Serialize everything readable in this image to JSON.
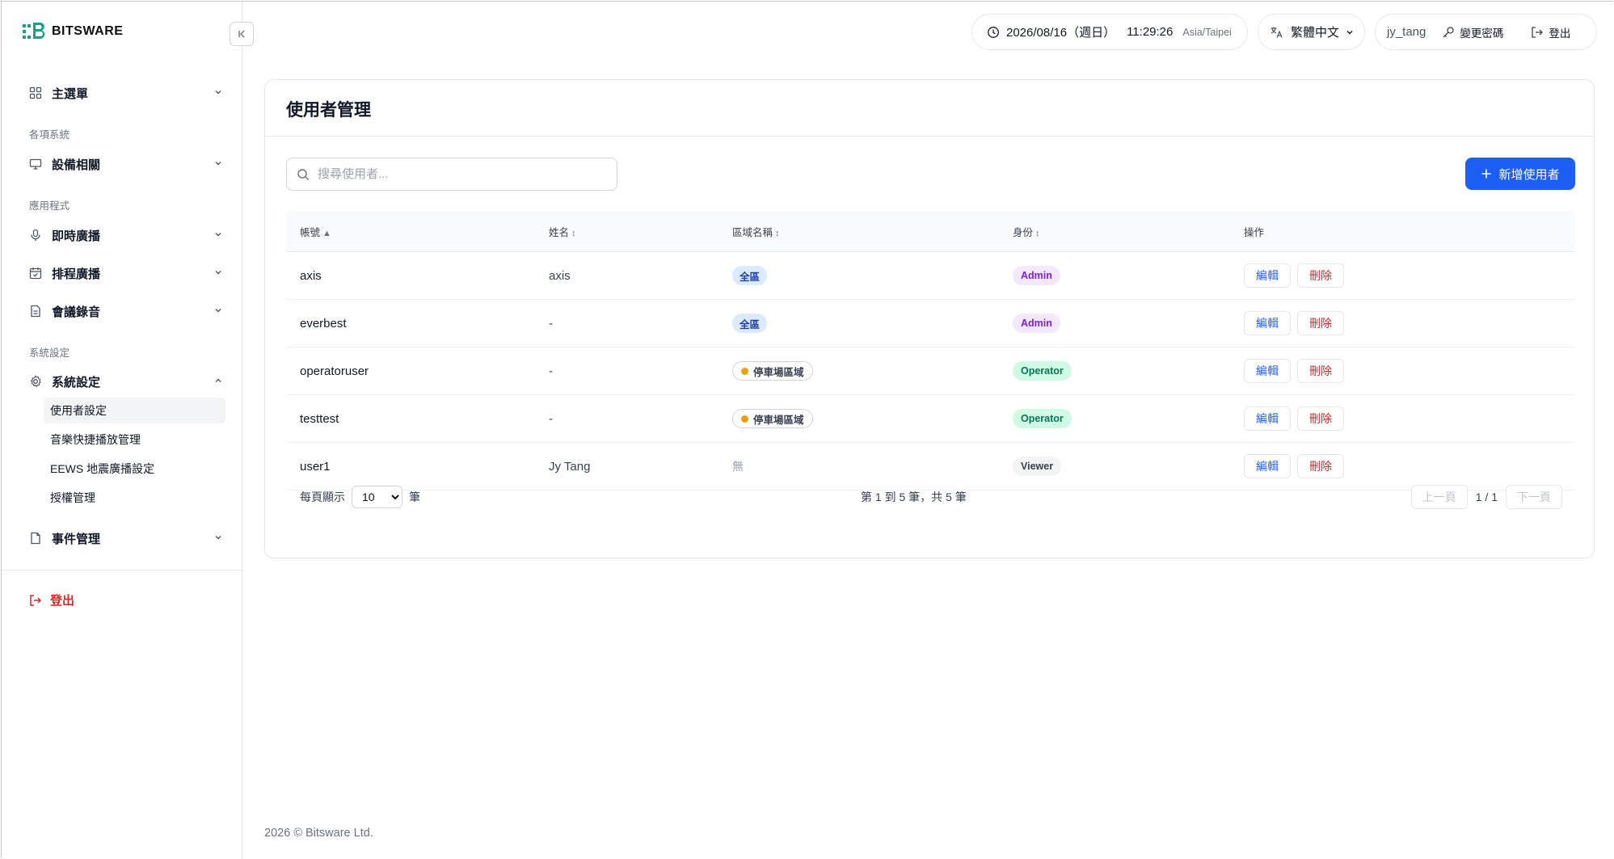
{
  "brand": {
    "name": "BITSWARE",
    "color": "#16a08a"
  },
  "topbar": {
    "date": "2026/08/16（週日）",
    "time": "11:29:26",
    "timezone": "Asia/Taipei",
    "language": "繁體中文",
    "username": "jy_tang",
    "change_password": "變更密碼",
    "logout": "登出"
  },
  "sidebar": {
    "main_menu": "主選單",
    "section_systems": "各項系統",
    "devices": "設備相關",
    "section_apps": "應用程式",
    "live_broadcast": "即時廣播",
    "scheduled_broadcast": "排程廣播",
    "meeting_recording": "會議錄音",
    "section_settings": "系統設定",
    "system_settings": "系統設定",
    "sub_items": [
      "使用者設定",
      "音樂快捷播放管理",
      "EEWS 地震廣播設定",
      "授權管理"
    ],
    "events": "事件管理",
    "logout": "登出"
  },
  "page": {
    "title": "使用者管理",
    "search_placeholder": "搜尋使用者...",
    "add_button": "新增使用者"
  },
  "table": {
    "headers": {
      "account": "帳號",
      "name": "姓名",
      "zone": "區域名稱",
      "role": "身份",
      "actions": "操作"
    },
    "sort_icons": {
      "account": "▲",
      "name": "↕",
      "zone": "↕",
      "role": "↕"
    },
    "edit_label": "編輯",
    "delete_label": "刪除",
    "rows": [
      {
        "account": "axis",
        "name": "axis",
        "zone": "全區",
        "role": "Admin"
      },
      {
        "account": "everbest",
        "name": "-",
        "zone": "全區",
        "role": "Admin"
      },
      {
        "account": "operatoruser",
        "name": "-",
        "zone": "停車場區域",
        "role": "Operator"
      },
      {
        "account": "testtest",
        "name": "-",
        "zone": "停車場區域",
        "role": "Operator"
      },
      {
        "account": "user1",
        "name": "Jy Tang",
        "zone": "無",
        "role": "Viewer"
      }
    ]
  },
  "pager": {
    "per_page_label": "每頁顯示",
    "per_page_value": "10",
    "per_page_unit": "筆",
    "info": "第 1 到 5 筆，共 5 筆",
    "prev": "上一頁",
    "page": "1 / 1",
    "next": "下一頁"
  },
  "footer": "2026 © Bitsware Ltd.",
  "colors": {
    "primary": "#1d5ff5",
    "danger": "#dc2626",
    "admin": "#7e22ce",
    "operator": "#047857"
  }
}
